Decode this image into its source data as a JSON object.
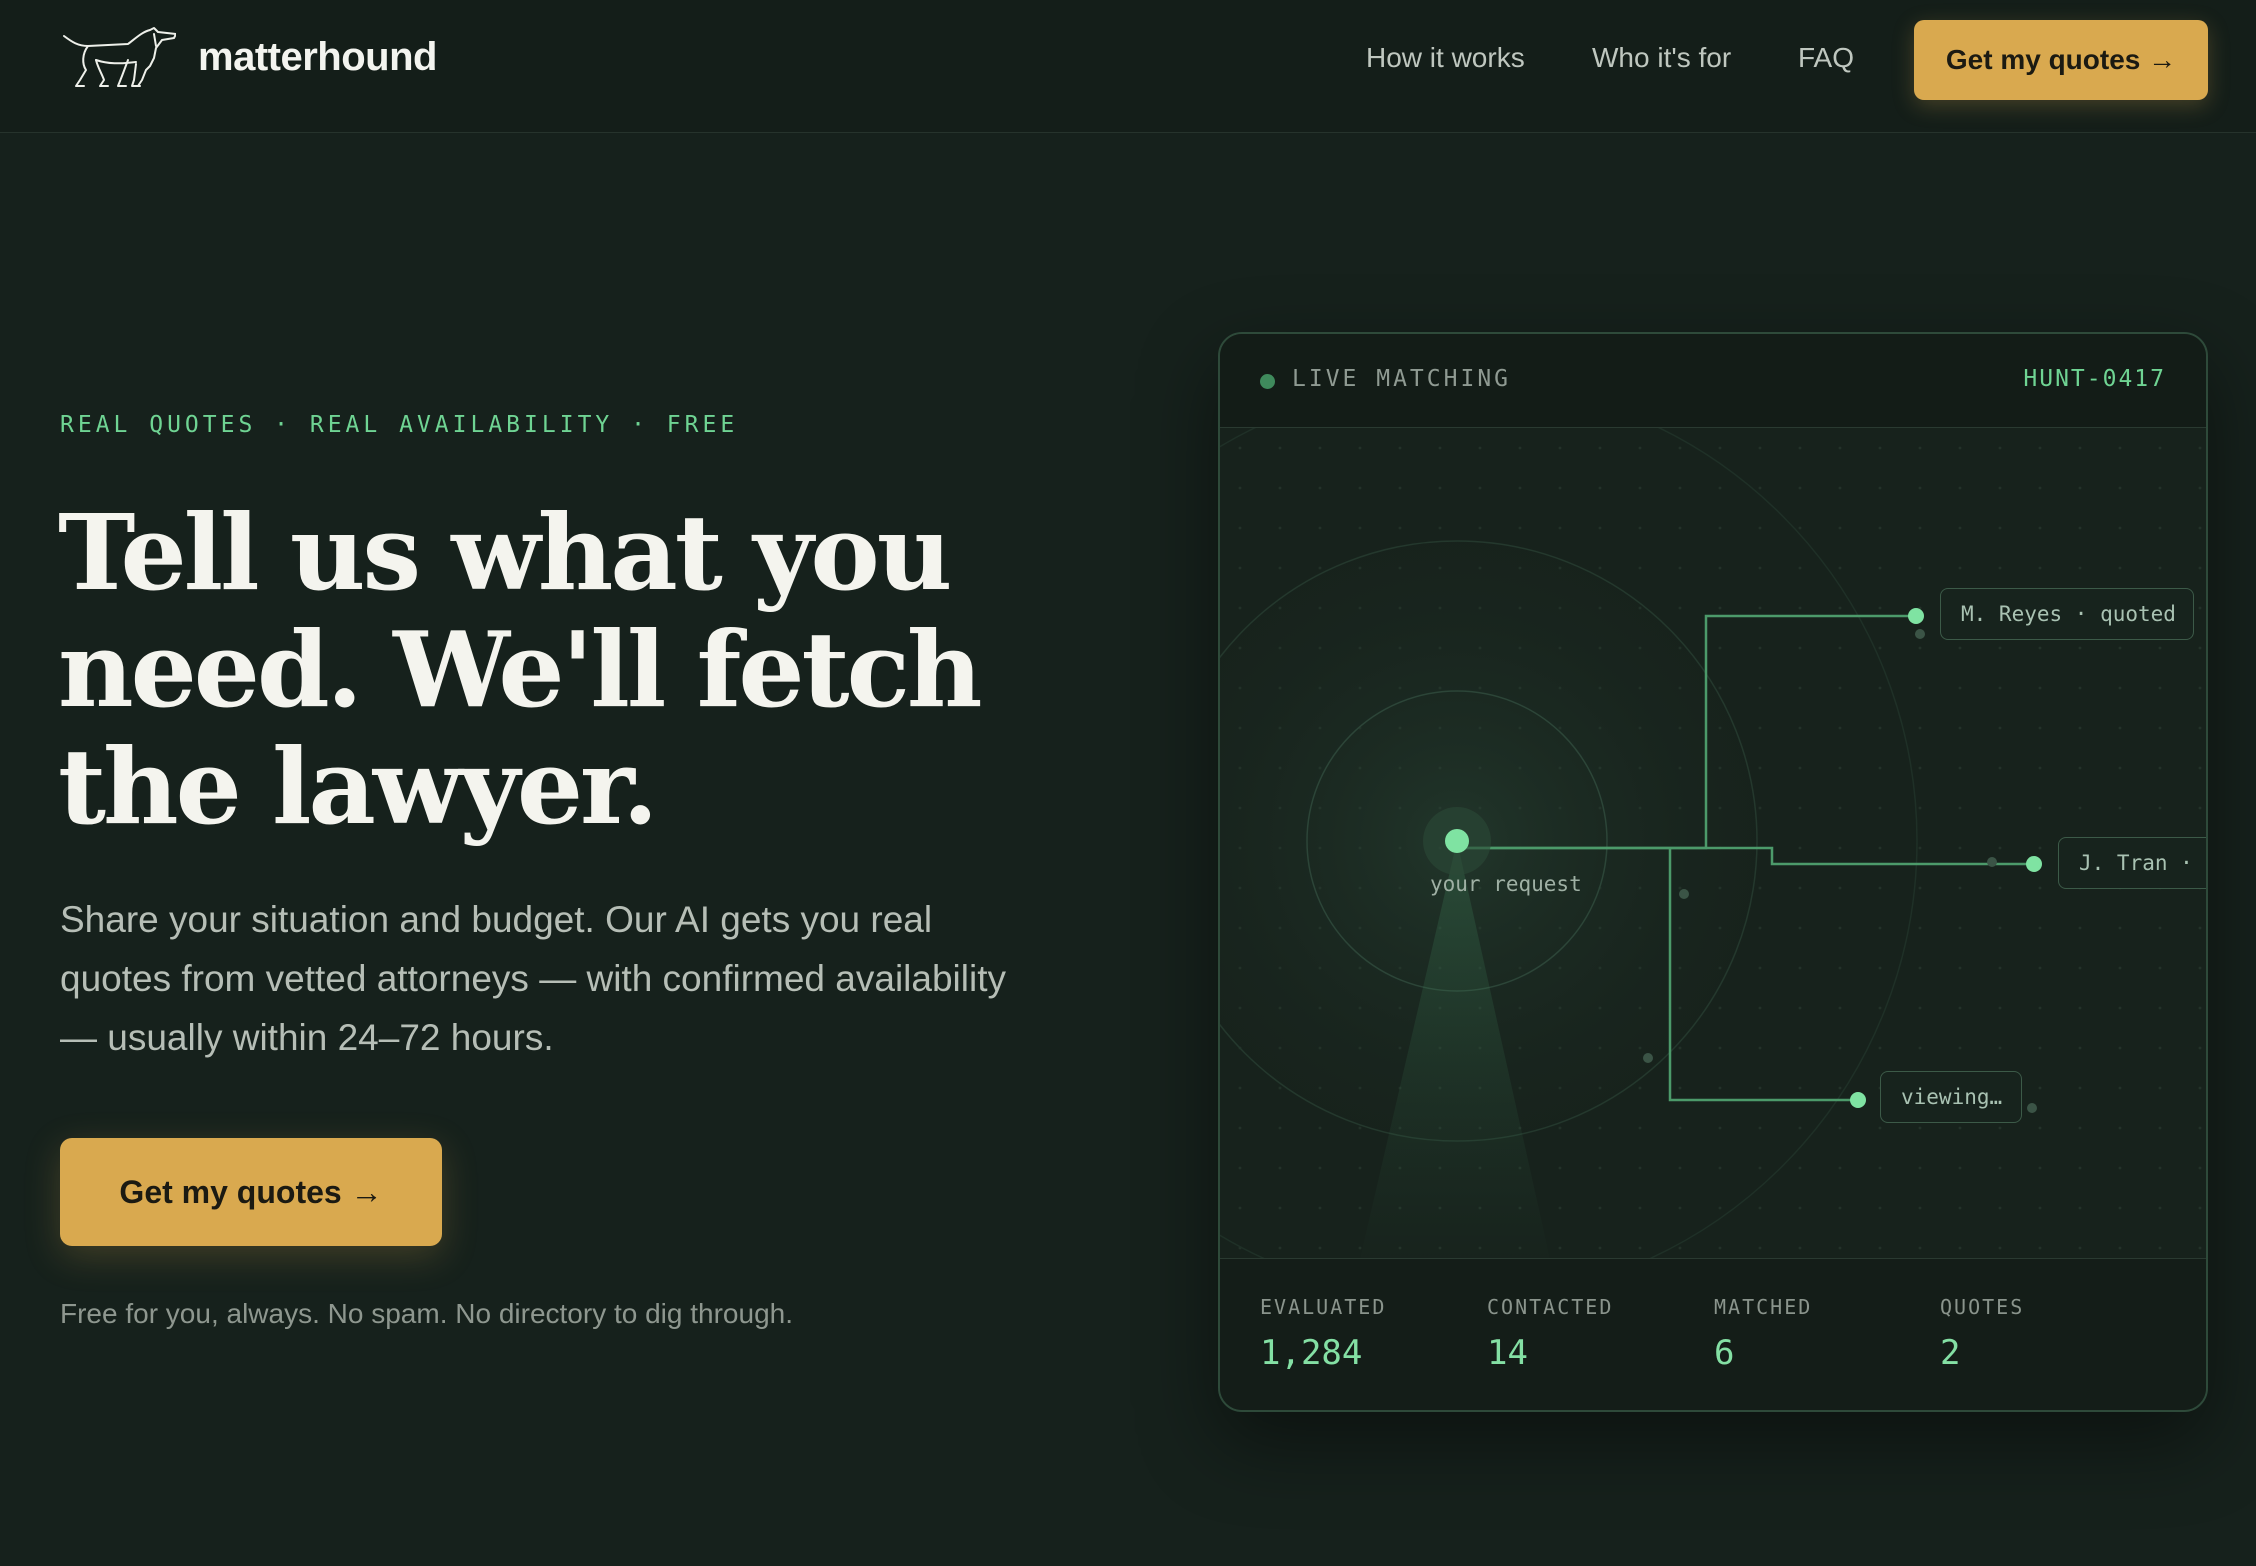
{
  "nav": {
    "brand": "matterhound",
    "logo_icon": "hound-icon",
    "links": [
      "How it works",
      "Who it's for",
      "FAQ"
    ],
    "cta_label": "Get my quotes →"
  },
  "hero": {
    "eyebrow": "REAL QUOTES · REAL AVAILABILITY · FREE",
    "headline_lines": [
      "Tell us what you",
      "need. We'll fetch",
      "the lawyer."
    ],
    "subtext": "Share your situation and budget. Our AI gets you real quotes from vetted attorneys — with confirmed availability — usually within 24–72 hours.",
    "cta_label": "Get my quotes →",
    "note": "Free for you, always. No spam. No directory to dig through."
  },
  "panel": {
    "status_label": "LIVE MATCHING",
    "hunt_id": "HUNT-0417",
    "center_label": "your request",
    "chips": [
      "M. Reyes · quoted",
      "J. Tran · q",
      "viewing…"
    ],
    "stats": [
      {
        "label": "EVALUATED",
        "value": "1,284"
      },
      {
        "label": "CONTACTED",
        "value": "14"
      },
      {
        "label": "MATCHED",
        "value": "6"
      },
      {
        "label": "QUOTES",
        "value": "2"
      }
    ]
  },
  "colors": {
    "background": "#16211c",
    "accent_gold": "#d9a94f",
    "accent_green": "#6fd493"
  }
}
